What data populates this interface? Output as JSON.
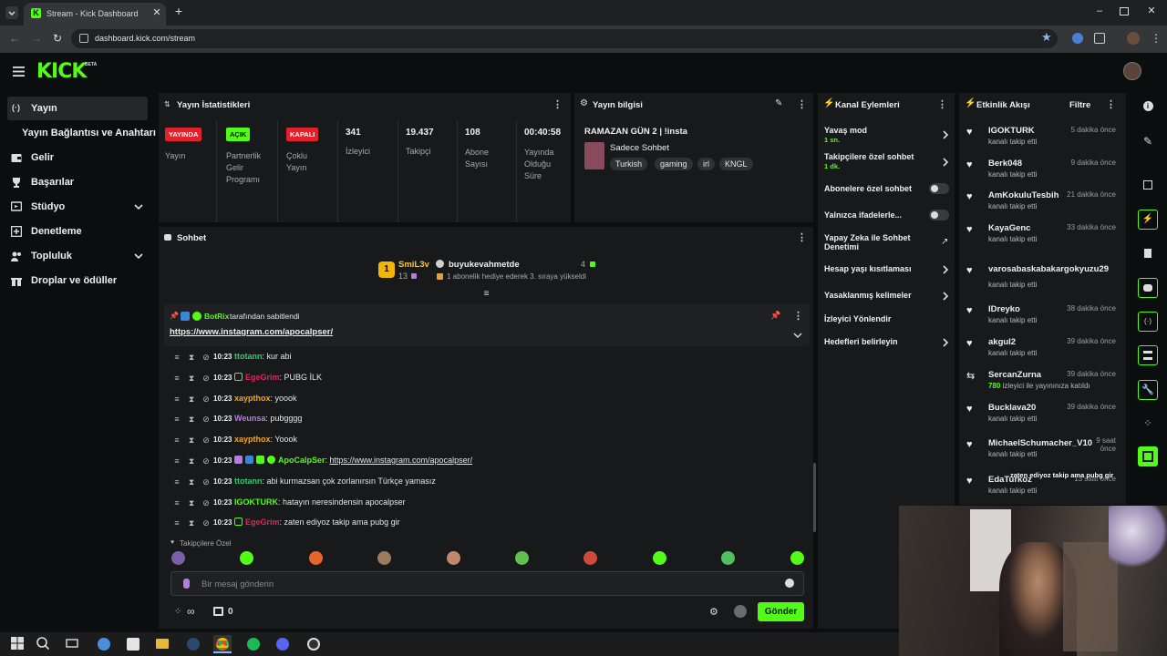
{
  "browser": {
    "tab_title": "Stream - Kick Dashboard",
    "url": "dashboard.kick.com/stream"
  },
  "app": {
    "logo": "KICK",
    "logo_tag": "BETA"
  },
  "sidebar": {
    "items": [
      {
        "label": "Yayın",
        "icon": "broadcast-icon",
        "active": true
      },
      {
        "label": "Yayın Bağlantısı ve Anahtarı",
        "icon": "",
        "active": false
      },
      {
        "label": "Gelir",
        "icon": "wallet-icon",
        "active": false
      },
      {
        "label": "Başarılar",
        "icon": "trophy-icon",
        "active": false
      },
      {
        "label": "Stüdyo",
        "icon": "studio-icon",
        "active": false,
        "expandable": true
      },
      {
        "label": "Denetleme",
        "icon": "mod-shield-icon",
        "active": false
      },
      {
        "label": "Topluluk",
        "icon": "community-icon",
        "active": false,
        "expandable": true
      },
      {
        "label": "Droplar ve ödüller",
        "icon": "gift-icon",
        "active": false
      }
    ]
  },
  "stats": {
    "title": "Yayın İstatistikleri",
    "badges": [
      {
        "badge": "YAYINDA",
        "label": "Yayın",
        "color": "#e2212b"
      },
      {
        "badge": "AÇIK",
        "label": "Partnerlik Gelir Programı",
        "color": "#53fc18"
      },
      {
        "badge": "KAPALI",
        "label": "Çoklu Yayın",
        "color": "#e2212b"
      }
    ],
    "numbers": [
      {
        "value": "341",
        "label": "İzleyici"
      },
      {
        "value": "19.437",
        "label": "Takipçi"
      },
      {
        "value": "108",
        "label": "Abone Sayısı"
      },
      {
        "value": "00:40:58",
        "label": "Yayında Olduğu Süre"
      }
    ]
  },
  "stream_info": {
    "title": "Yayın bilgisi",
    "stream_title": "RAMAZAN GÜN 2 | !insta",
    "category": "Sadece Sohbet",
    "tags": [
      "Turkish",
      "gaming",
      "irl",
      "KNGL"
    ]
  },
  "channel_actions": {
    "title": "Kanal Eylemleri",
    "items": [
      {
        "label": "Yavaş mod",
        "sub": "1 sn.",
        "control": "chevron"
      },
      {
        "label": "Takipçilere özel sohbet",
        "sub": "1 dk.",
        "control": "chevron"
      },
      {
        "label": "Abonelere özel sohbet",
        "sub": "",
        "control": "toggle"
      },
      {
        "label": "Yalnızca ifadelerle...",
        "sub": "",
        "control": "toggle"
      },
      {
        "label": "Yapay Zeka ile Sohbet Denetimi",
        "sub": "",
        "control": "external"
      },
      {
        "label": "Hesap yaşı kısıtlaması",
        "sub": "",
        "control": "chevron"
      },
      {
        "label": "Yasaklanmış kelimeler",
        "sub": "",
        "control": "chevron"
      },
      {
        "label": "İzleyici Yönlendir",
        "sub": "",
        "control": "none"
      },
      {
        "label": "Hedefleri belirleyin",
        "sub": "",
        "control": "chevron"
      }
    ]
  },
  "activity": {
    "title": "Etkinlik Akışı",
    "filter": "Filtre",
    "items": [
      {
        "name": "IGOKTURK",
        "time": "5 dakika önce",
        "sub": "kanalı takip etti",
        "icon": "heart-icon"
      },
      {
        "name": "Berk048",
        "time": "9 dakika önce",
        "sub": "kanalı takip etti",
        "icon": "heart-icon"
      },
      {
        "name": "AmKokuluTesbih",
        "time": "21 dakika önce",
        "sub": "kanalı takip etti",
        "icon": "heart-icon"
      },
      {
        "name": "KayaGenc",
        "time": "33 dakika önce",
        "sub": "kanalı takip etti",
        "icon": "heart-icon"
      },
      {
        "name": "varosabaskabakargokyuzu29",
        "time": "",
        "sub": "kanalı takip etti",
        "icon": "heart-icon"
      },
      {
        "name": "IDreyko",
        "time": "38 dakika önce",
        "sub": "kanalı takip etti",
        "icon": "heart-icon"
      },
      {
        "name": "akgul2",
        "time": "39 dakika önce",
        "sub": "kanalı takip etti",
        "icon": "heart-icon"
      },
      {
        "name": "SercanZurna",
        "time": "39 dakika önce",
        "sub_count": "780",
        "sub": "izleyici ile yayınınıza katıldı",
        "icon": "raid-icon"
      },
      {
        "name": "Bucklava20",
        "time": "39 dakika önce",
        "sub": "kanalı takip etti",
        "icon": "heart-icon"
      },
      {
        "name": "MichaelSchumacher_V10",
        "time": "9 saat önce",
        "sub": "kanalı takip etti",
        "icon": "heart-icon"
      },
      {
        "name": "EdaTurkoz",
        "time": "13 saat önce",
        "sub": "kanalı takip etti",
        "icon": "heart-icon"
      }
    ],
    "overlay_text": "zaten ediyoz takip ama pubg gir"
  },
  "chat": {
    "title": "Sohbet",
    "gift_banner": {
      "gifter": "SmiL3v",
      "gifter_count": "13",
      "rank": "1",
      "receiver": "buyukevahmetde",
      "receiver_count": "4",
      "text": "1 abonelik hediye ederek 3. sıraya yükseldi"
    },
    "pinned": {
      "by": "BotRix",
      "by_suffix": "tarafından sabitlendi",
      "link": "https://www.instagram.com/apocalpser/"
    },
    "messages": [
      {
        "time": "10:23",
        "user": "ttotann",
        "color": "#2ecc71",
        "text": "kur abi",
        "badges": []
      },
      {
        "time": "10:23",
        "user": "EgeGrim",
        "color": "#e0245e",
        "text": "PUBG İLK",
        "badges": [
          "og-icon"
        ]
      },
      {
        "time": "10:23",
        "user": "xaypthox",
        "color": "#f5a623",
        "text": "yoook",
        "badges": []
      },
      {
        "time": "10:23",
        "user": "Weunsa",
        "color": "#b57edc",
        "text": "pubgggg",
        "badges": []
      },
      {
        "time": "10:23",
        "user": "xaypthox",
        "color": "#f5a623",
        "text": "Yoook",
        "badges": []
      },
      {
        "time": "10:23",
        "user": "ApoCalpSer",
        "color": "#53fc18",
        "text": "https://www.instagram.com/apocalpser/",
        "link": true,
        "badges": [
          "mic-icon",
          "vip-icon",
          "mod-icon",
          "verified-icon"
        ]
      },
      {
        "time": "10:23",
        "user": "ttotann",
        "color": "#2ecc71",
        "text": "abi kurmazsan çok zorlanırsın Türkçe yamasız",
        "badges": []
      },
      {
        "time": "10:23",
        "user": "IGOKTURK",
        "color": "#53fc18",
        "text": "hatayın neresindensin apocalpser",
        "badges": []
      },
      {
        "time": "10:23",
        "user": "EgeGrim",
        "color": "#e0245e",
        "text": "zaten ediyoz takip ama pubg gir",
        "badges": [
          "og-icon"
        ]
      }
    ],
    "emote_label": "Takipçilere Özel",
    "input_placeholder": "Bir mesaj gönderin",
    "points": "∞",
    "drops": "0",
    "send_label": "Gönder"
  },
  "colors": {
    "accent": "#53fc18",
    "live": "#e2212b",
    "panel": "#18191b",
    "background": "#0b0e0f"
  }
}
